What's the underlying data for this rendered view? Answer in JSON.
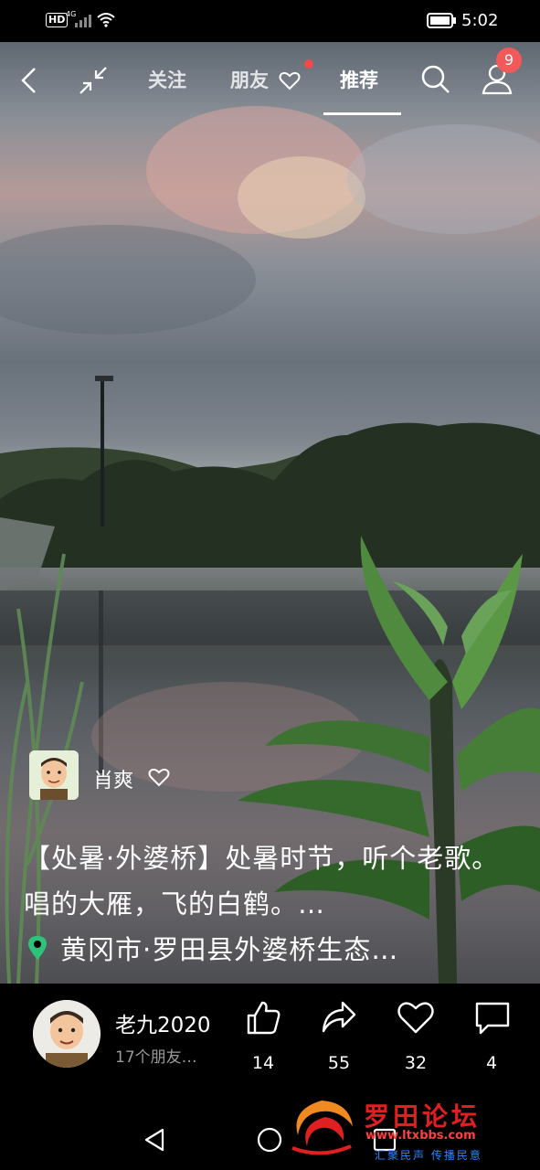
{
  "status_bar": {
    "hd": "HD",
    "network": "4G",
    "time": "5:02"
  },
  "nav": {
    "tabs": [
      {
        "label": "关注",
        "active": false
      },
      {
        "label": "朋友",
        "active": false
      },
      {
        "label": "推荐",
        "active": true
      }
    ],
    "notification_count": "9"
  },
  "post": {
    "author": "肖爽",
    "caption": "【处暑·外婆桥】处暑时节，听个老歌。唱的大雁，飞的白鹤。…",
    "location": "黄冈市·罗田县外婆桥生态…"
  },
  "footer": {
    "user_name": "老九2020",
    "user_sub": "17个朋友…",
    "likes": "14",
    "shares": "55",
    "favorites": "32",
    "comments": "4"
  },
  "watermark": {
    "text": "罗田论坛",
    "url": "www.ltxbbs.com",
    "slogan": "汇聚民声 传播民意"
  },
  "colors": {
    "accent": "#f25a5a",
    "pin": "#2fc27a",
    "watermark": "#e02020"
  }
}
